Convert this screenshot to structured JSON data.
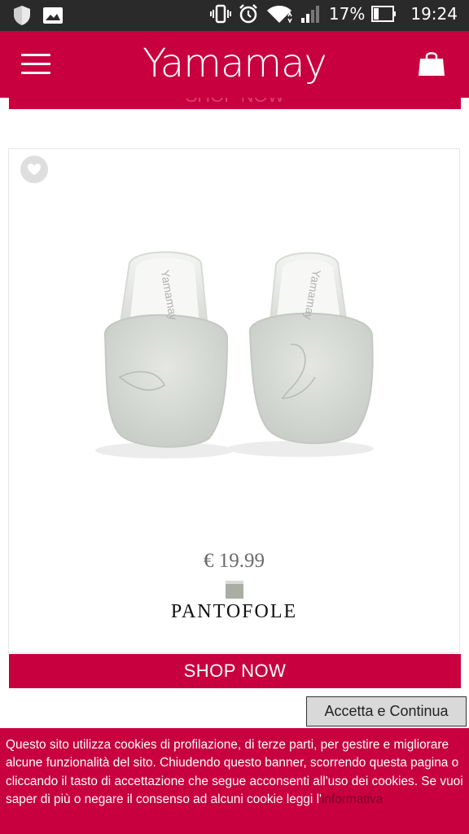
{
  "status_bar": {
    "battery": "17%",
    "time": "19:24"
  },
  "header": {
    "brand": "Yamamay"
  },
  "product": {
    "price": "€ 19.99",
    "name": "PANTOFOLE",
    "image_brand": "Yamamay",
    "cta": "SHOP NOW"
  },
  "top_button": {
    "label": "SHOP NOW"
  },
  "cookie": {
    "accept_label": "Accetta e Continua",
    "text": "Questo sito utilizza cookies di profilazione, di terze parti, per gestire e migliorare alcune funzionalità del sito. Chiudendo questo banner, scorrendo questa pagina o cliccando il tasto di accettazione che segue acconsenti all'uso dei cookies. Se vuoi saper di più o negare il consenso ad alcuni cookie leggi l'",
    "link": "informativa"
  },
  "colors": {
    "brand": "#c8003f",
    "status_bar": "#2a2a2a"
  },
  "icons": [
    "shield-icon",
    "gallery-icon",
    "vibrate-icon",
    "alarm-icon",
    "wifi-icon",
    "signal-icon",
    "battery-icon",
    "menu-icon",
    "shopping-bag-icon",
    "heart-icon"
  ]
}
